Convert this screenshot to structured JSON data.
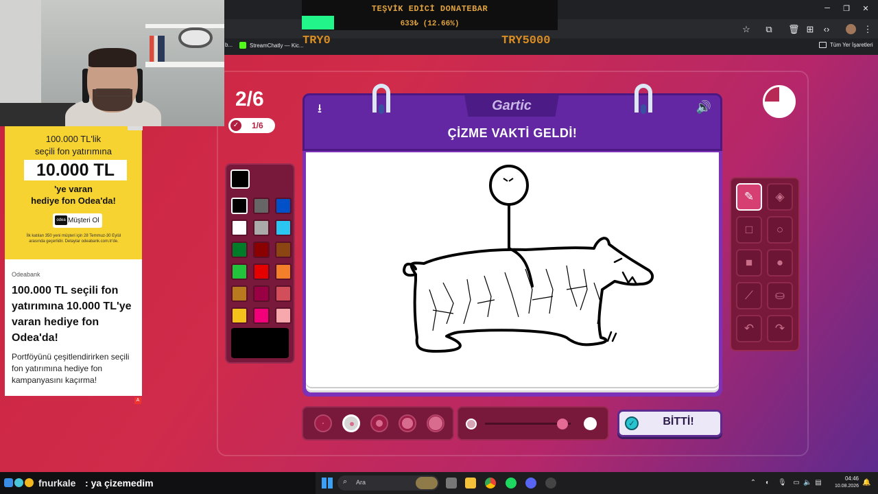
{
  "donation": {
    "title": "TEŞVİK EDİCİ DONATEBAR",
    "amount": "633₺ (12.66%)",
    "progress": 0.1266,
    "min_label": "TRY0",
    "max_label": "TRY5000"
  },
  "browser": {
    "bookmark_stub": "b...",
    "bookmark_1": "StreamChatly — Kic...",
    "bookmark_folder": "Tüm Yer İşaretleri",
    "icons": [
      "star-icon",
      "extensions-icon",
      "delete-icon",
      "apps-icon",
      "devtools-icon",
      "profile-icon",
      "menu-icon"
    ]
  },
  "game": {
    "round": "2/6",
    "done_count": "1/6",
    "logo": "Gartic",
    "title": "ÇİZME VAKTİ GELDİ!",
    "done_button": "BİTTİ!",
    "timer_remaining": 0.75,
    "current_color": "#000000",
    "palette": [
      "#000000",
      "#666666",
      "#0050c8",
      "#ffffff",
      "#aaaaaa",
      "#2bc7f2",
      "#007b28",
      "#8b0000",
      "#8b4513",
      "#22c43c",
      "#e50000",
      "#f47f2a",
      "#b8791f",
      "#9a0044",
      "#d14e5a",
      "#f5c21b",
      "#f2007a",
      "#f7a8ad"
    ],
    "selected_swatch": 0,
    "tools": [
      {
        "id": "pencil",
        "icon": "✎",
        "active": true
      },
      {
        "id": "eraser",
        "icon": "◈",
        "active": false
      },
      {
        "id": "rectangle",
        "icon": "□",
        "active": false
      },
      {
        "id": "ellipse",
        "icon": "○",
        "active": false
      },
      {
        "id": "filled-rectangle",
        "icon": "■",
        "active": false
      },
      {
        "id": "filled-ellipse",
        "icon": "●",
        "active": false
      },
      {
        "id": "line",
        "icon": "⟋",
        "active": false
      },
      {
        "id": "bucket",
        "icon": "⛀",
        "active": false
      },
      {
        "id": "undo",
        "icon": "↶",
        "active": false
      },
      {
        "id": "redo",
        "icon": "↷",
        "active": false
      }
    ],
    "brush_sizes": 5,
    "selected_size": 1,
    "opacity": 0.9
  },
  "ad": {
    "line1": "100.000 TL'lik",
    "line2": "seçili fon yatırımına",
    "big": "10.000 TL",
    "line3": "'ye varan",
    "line4": "hediye fon Odea'da!",
    "button": "Müşteri Ol",
    "button_logo": "odea",
    "fine": "İlk katılan 350 yeni müşteri için 28 Temmuz-30 Eylül arasında geçerlidir. Detaylar odeabank.com.tr'de.",
    "brand": "Odeabank",
    "headline": "100.000 TL seçili fon yatırımına 10.000 TL'ye varan hediye fon Odea'da!",
    "desc": "Portföyünü çeşitlendirirken seçili fon yatırımına hediye fon kampanyasını kaçırma!",
    "mark": "A"
  },
  "chat": {
    "user": "fnurkale",
    "separator": ":",
    "message": "ya çizemedim"
  },
  "taskbar": {
    "search": "Ara",
    "time": "04:46",
    "date": "10.08.2026"
  }
}
